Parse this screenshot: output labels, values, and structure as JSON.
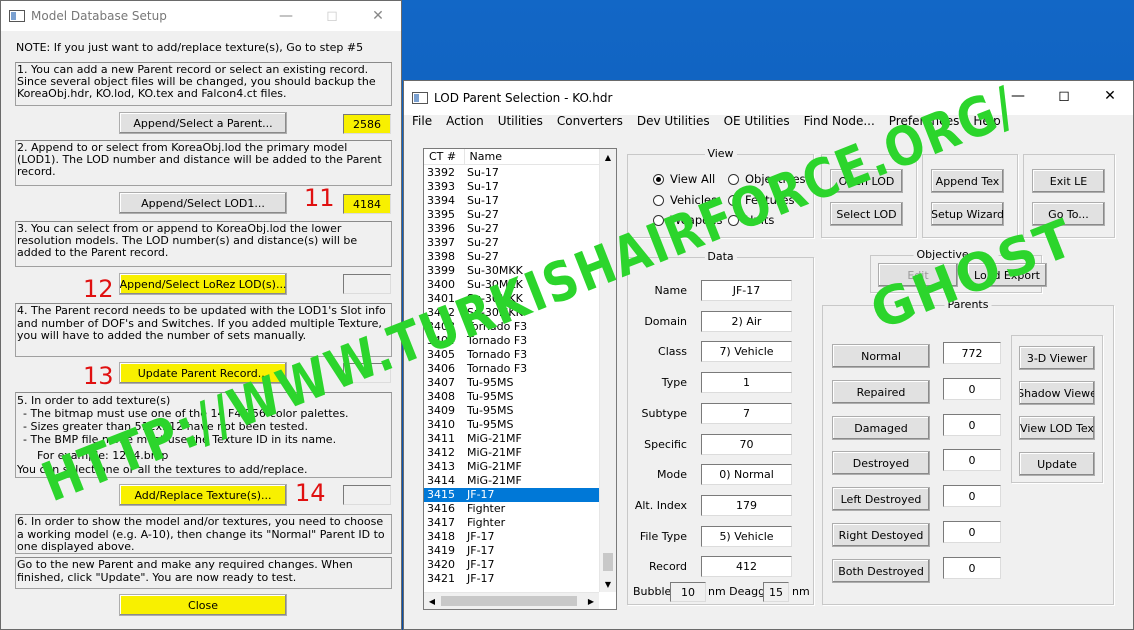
{
  "model_setup": {
    "title": "Model Database Setup",
    "note": "NOTE:  If you just want to add/replace texture(s), Go to step #5",
    "step1_text": "1.  You can add a new Parent record or select an existing record.  Since several object files will be changed, you should backup the KoreaObj.hdr, KO.lod, KO.tex and Falcon4.ct  files.",
    "step1_button": "Append/Select a Parent...",
    "step1_value": "2586",
    "step2_text": "2.  Append to or select from KoreaObj.lod the primary model (LOD1).  The LOD number and distance will be added to the Parent record.",
    "step2_button": "Append/Select LOD1...",
    "step2_value": "4184",
    "step2_num": "11",
    "step3_text": "3.  You can select from or append  to KoreaObj.lod the lower resolution models.  The LOD number(s) and distance(s) will be added to the Parent record.",
    "step3_button": "Append/Select LoRez LOD(s)...",
    "step3_value": "",
    "step3_num": "12",
    "step4_text": "4.  The Parent record needs to be updated with the LOD1's Slot info and number of DOF's and Switches.  If you added multiple Texture, you will have to added the number of sets manually.",
    "step4_button": "Update Parent Record...",
    "step4_value": "",
    "step4_num": "13",
    "step5_intro": "5.  In order to add texture(s)",
    "step5_b1": " - The bitmap must use one of the 14 F4 256-color palettes.",
    "step5_b2": " - Sizes greater than 512x512 have not been tested.",
    "step5_b3": " - The BMP file name must use the Texture ID in its name.",
    "step5_example": "For example: 1234.bmp",
    "step5_tail": "You can select one or all the textures to add/replace.",
    "step5_button": "Add/Replace Texture(s)...",
    "step5_value": "",
    "step5_num": "14",
    "step6_text": "6.  In order to show the model and/or textures, you need to choose a working model (e.g. A-10), then change its \"Normal\" Parent ID to one displayed above.",
    "final_text": "Go to the new Parent and make any required changes.  When finished, click \"Update\".  You are now ready to test.",
    "close_button": "Close"
  },
  "lod_parent": {
    "title": "LOD Parent Selection - KO.hdr",
    "menu": [
      "File",
      "Action",
      "Utilities",
      "Converters",
      "Dev Utilities",
      "OE Utilities",
      "Find Node...",
      "Preferences",
      "Help"
    ],
    "list_headers": [
      "CT #",
      "Name"
    ],
    "rows": [
      [
        "3392",
        "Su-17"
      ],
      [
        "3393",
        "Su-17"
      ],
      [
        "3394",
        "Su-17"
      ],
      [
        "3395",
        "Su-27"
      ],
      [
        "3396",
        "Su-27"
      ],
      [
        "3397",
        "Su-27"
      ],
      [
        "3398",
        "Su-27"
      ],
      [
        "3399",
        "Su-30MKK"
      ],
      [
        "3400",
        "Su-30MKK"
      ],
      [
        "3401",
        "Su-30MKK"
      ],
      [
        "3402",
        "Su-30MKK"
      ],
      [
        "3403",
        "Tornado F3"
      ],
      [
        "3404",
        "Tornado F3"
      ],
      [
        "3405",
        "Tornado F3"
      ],
      [
        "3406",
        "Tornado F3"
      ],
      [
        "3407",
        "Tu-95MS"
      ],
      [
        "3408",
        "Tu-95MS"
      ],
      [
        "3409",
        "Tu-95MS"
      ],
      [
        "3410",
        "Tu-95MS"
      ],
      [
        "3411",
        "MiG-21MF"
      ],
      [
        "3412",
        "MiG-21MF"
      ],
      [
        "3413",
        "MiG-21MF"
      ],
      [
        "3414",
        "MiG-21MF"
      ],
      [
        "3415",
        "JF-17"
      ],
      [
        "3416",
        "Fighter"
      ],
      [
        "3417",
        "Fighter"
      ],
      [
        "3418",
        "JF-17"
      ],
      [
        "3419",
        "JF-17"
      ],
      [
        "3420",
        "JF-17"
      ],
      [
        "3421",
        "JF-17"
      ]
    ],
    "selected_ct": "3415",
    "view_legend": "View",
    "view_options": [
      "View All",
      "Objectives",
      "Vehicles",
      "Features",
      "Weapons",
      "Units"
    ],
    "view_selected": "View All",
    "buttons": {
      "open_lod": "Open LOD",
      "select_lod": "Select LOD",
      "append_tex": "Append Tex",
      "setup_wizard": "Setup Wizard",
      "exit_le": "Exit LE",
      "go_to": "Go To...",
      "edit": "Edit",
      "load_export": "Load Export",
      "viewer_3d": "3-D Viewer",
      "shadow_viewer": "Shadow Viewe",
      "view_lod_tex": "View LOD Tex",
      "update": "Update"
    },
    "objective_editor_legend": "Objective Editor",
    "data_legend": "Data",
    "data_fields": [
      {
        "label": "Name",
        "value": "JF-17"
      },
      {
        "label": "Domain",
        "value": "2) Air"
      },
      {
        "label": "Class",
        "value": "7) Vehicle"
      },
      {
        "label": "Type",
        "value": "1"
      },
      {
        "label": "Subtype",
        "value": "7"
      },
      {
        "label": "Specific",
        "value": "70"
      },
      {
        "label": "Mode",
        "value": "0) Normal"
      },
      {
        "label": "Alt. Index",
        "value": "179"
      },
      {
        "label": "File Type",
        "value": "5) Vehicle"
      },
      {
        "label": "Record",
        "value": "412"
      }
    ],
    "bubble_label": "Bubble",
    "bubble_value": "10",
    "nm_deagg_label": "nm Deagg",
    "deagg_value": "15",
    "nm_label": "nm",
    "parents_legend": "Parents",
    "parents": [
      {
        "label": "Normal",
        "value": "772"
      },
      {
        "label": "Repaired",
        "value": "0"
      },
      {
        "label": "Damaged",
        "value": "0"
      },
      {
        "label": "Destroyed",
        "value": "0"
      },
      {
        "label": "Left Destroyed",
        "value": "0"
      },
      {
        "label": "Right Destoyed",
        "value": "0"
      },
      {
        "label": "Both Destroyed",
        "value": "0"
      }
    ]
  },
  "watermark": {
    "line1": "HTTP://WWW.TURKISHAIRFORCE.ORG/",
    "line2": "GHOST"
  },
  "colors": {
    "highlight": "#f8f000",
    "step_numbers": "#e01010",
    "watermark": "#2cd52c",
    "selection": "#0078d7",
    "desktop": "#0a5fbf"
  }
}
